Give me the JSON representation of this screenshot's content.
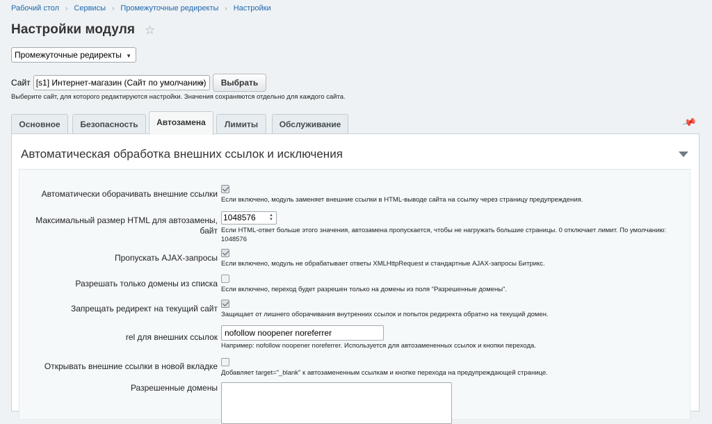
{
  "breadcrumbs": [
    "Рабочий стол",
    "Сервисы",
    "Промежуточные редиректы",
    "Настройки"
  ],
  "page_title": "Настройки модуля",
  "module_select": {
    "value": "Промежуточные редиректы"
  },
  "site": {
    "label": "Сайт",
    "value": "[s1] Интернет-магазин (Сайт по умолчанию)",
    "button_label": "Выбрать",
    "hint": "Выберите сайт, для которого редактируются настройки. Значения сохраняются отдельно для каждого сайта."
  },
  "tabs": [
    {
      "label": "Основное",
      "active": false
    },
    {
      "label": "Безопасность",
      "active": false
    },
    {
      "label": "Автозамена",
      "active": true
    },
    {
      "label": "Лимиты",
      "active": false
    },
    {
      "label": "Обслуживание",
      "active": false
    }
  ],
  "section": {
    "title": "Автоматическая обработка внешних ссылок и исключения",
    "rows": [
      {
        "label": "Автоматически оборачивать внешние ссылки",
        "checked": true,
        "hint": "Если включено, модуль заменяет внешние ссылки в HTML-выводе сайта на ссылку через страницу предупреждения."
      },
      {
        "label_line1": "Максимальный размер HTML для автозамены,",
        "label_line2": "байт",
        "value": "1048576",
        "hint_line1": "Если HTML-ответ больше этого значения, автозамена пропускается, чтобы не нагружать большие страницы. 0 отключает лимит. По умолчанию:",
        "hint_line2": "1048576"
      },
      {
        "label": "Пропускать AJAX-запросы",
        "checked": true,
        "hint": "Если включено, модуль не обрабатывает ответы XMLHttpRequest и стандартные AJAX-запросы Битрикс."
      },
      {
        "label": "Разрешать только домены из списка",
        "checked": false,
        "hint": "Если включено, переход будет разрешен только на домены из поля \"Разрешенные домены\"."
      },
      {
        "label": "Запрещать редирект на текущий сайт",
        "checked": true,
        "hint": "Защищает от лишнего оборачивания внутренних ссылок и попыток редиректа обратно на текущий домен."
      },
      {
        "label": "rel для внешних ссылок",
        "value": "nofollow noopener noreferrer",
        "hint": "Например: nofollow noopener noreferrer. Используется для автозамененных ссылок и кнопки перехода."
      },
      {
        "label": "Открывать внешние ссылки в новой вкладке",
        "checked": false,
        "hint": "Добавляет target=\"_blank\" к автозамененным ссылкам и кнопке перехода на предупреждающей странице."
      },
      {
        "label": "Разрешенные домены",
        "value": ""
      }
    ]
  },
  "icons": {
    "breadcrumb_separator": "chevron-right-icon",
    "favorite": "star-icon",
    "pin": "pin-icon",
    "collapse": "triangle-down-icon",
    "dropdown": "chevron-down-icon"
  }
}
